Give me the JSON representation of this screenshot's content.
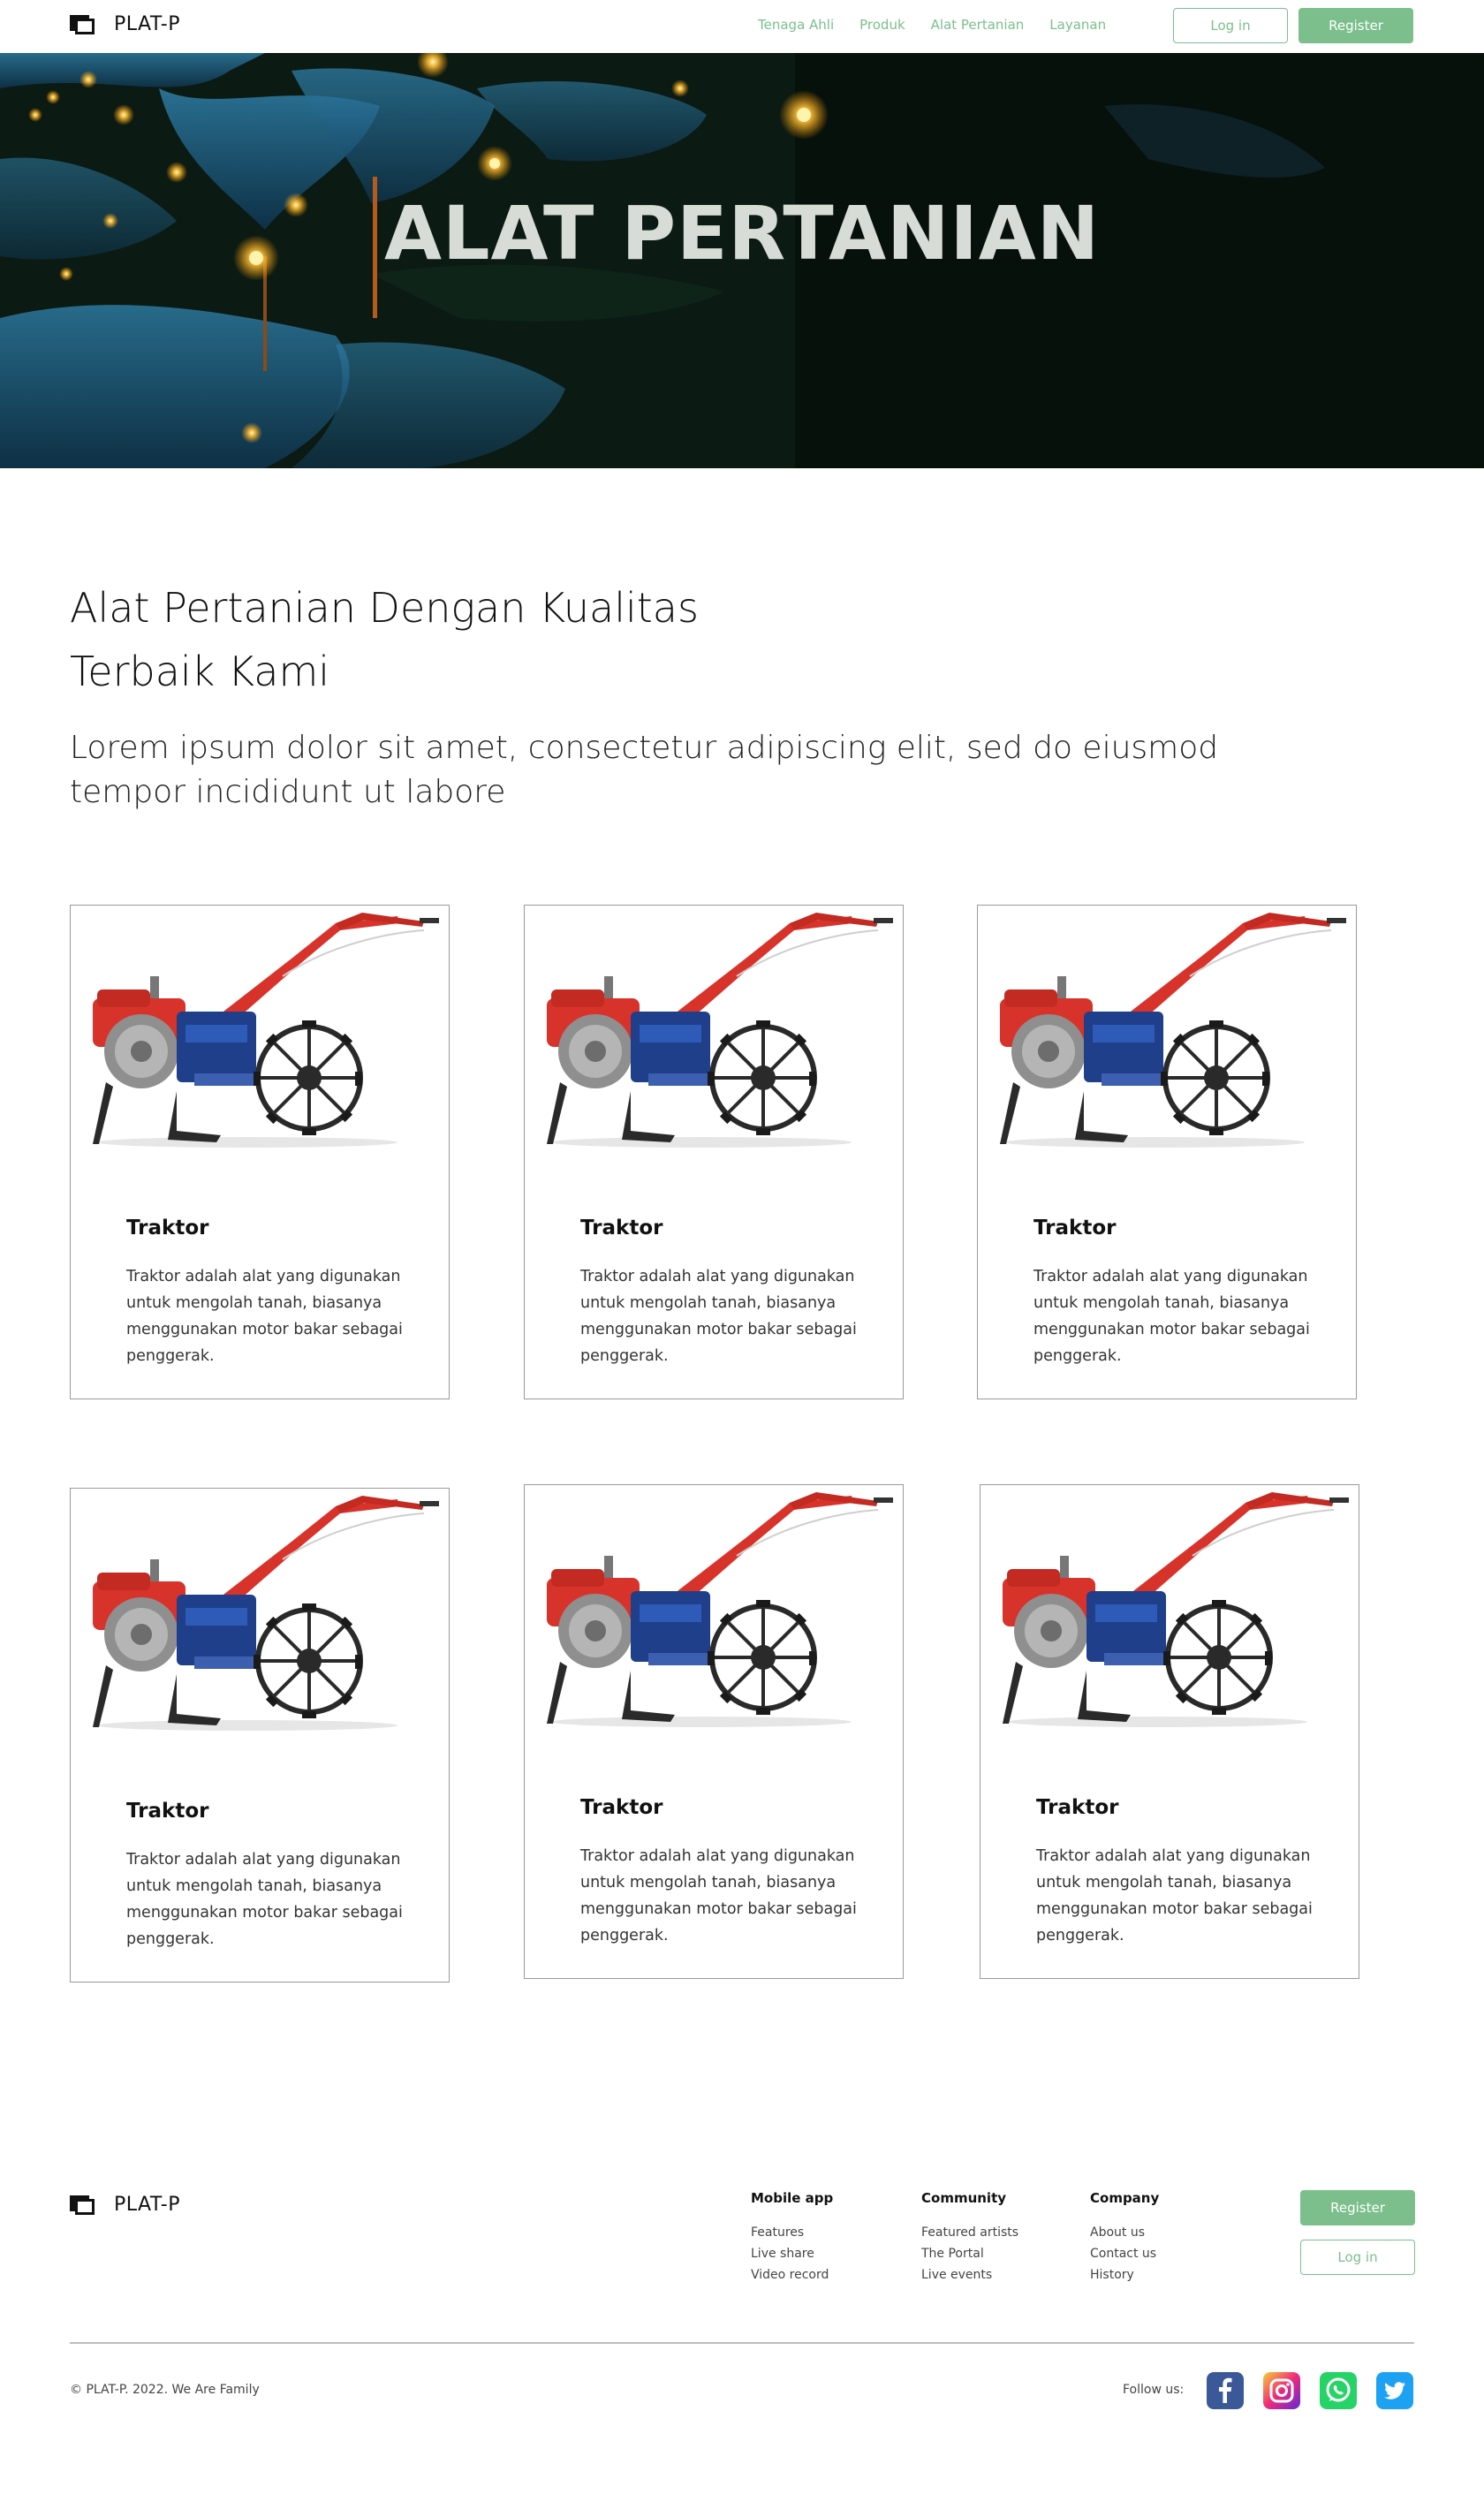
{
  "brand": {
    "name": "PLAT-P"
  },
  "nav": {
    "links": [
      "Tenaga Ahli",
      "Produk",
      "Alat Pertanian",
      "Layanan"
    ],
    "login_label": "Log in",
    "register_label": "Register"
  },
  "hero": {
    "title": "ALAT PERTANIAN"
  },
  "intro": {
    "heading_line1": "Alat Pertanian Dengan Kualitas",
    "heading_line2": "Terbaik Kami",
    "subtitle": "Lorem ipsum dolor sit amet, consectetur adipiscing elit, sed do eiusmod tempor incididunt ut labore"
  },
  "products": [
    {
      "title": "Traktor",
      "description": "Traktor adalah alat yang digunakan untuk mengolah tanah, biasanya menggunakan motor bakar sebagai penggerak."
    },
    {
      "title": "Traktor",
      "description": "Traktor adalah alat yang digunakan untuk mengolah tanah, biasanya menggunakan motor bakar sebagai penggerak."
    },
    {
      "title": "Traktor",
      "description": "Traktor adalah alat yang digunakan untuk mengolah tanah, biasanya menggunakan motor bakar sebagai penggerak."
    },
    {
      "title": "Traktor",
      "description": "Traktor adalah alat yang digunakan untuk mengolah tanah, biasanya menggunakan motor bakar sebagai penggerak."
    },
    {
      "title": "Traktor",
      "description": "Traktor adalah alat yang digunakan untuk mengolah tanah, biasanya menggunakan motor bakar sebagai penggerak."
    },
    {
      "title": "Traktor",
      "description": "Traktor adalah alat yang digunakan untuk mengolah tanah, biasanya menggunakan motor bakar sebagai penggerak."
    }
  ],
  "footer": {
    "columns": [
      {
        "heading": "Mobile app",
        "links": [
          "Features",
          "Live share",
          "Video record"
        ]
      },
      {
        "heading": "Community",
        "links": [
          "Featured artists",
          "The Portal",
          "Live events"
        ]
      },
      {
        "heading": "Company",
        "links": [
          "About us",
          "Contact us",
          "History"
        ]
      }
    ],
    "register_label": "Register",
    "login_label": "Log in",
    "copyright": "© PLAT-P. 2022. We Are Family",
    "follow_label": "Follow us:",
    "socials": [
      "facebook-icon",
      "instagram-icon",
      "whatsapp-icon",
      "twitter-icon"
    ]
  },
  "colors": {
    "accent": "#7cbf8c",
    "text": "#111111",
    "border": "#9a9a9a"
  }
}
